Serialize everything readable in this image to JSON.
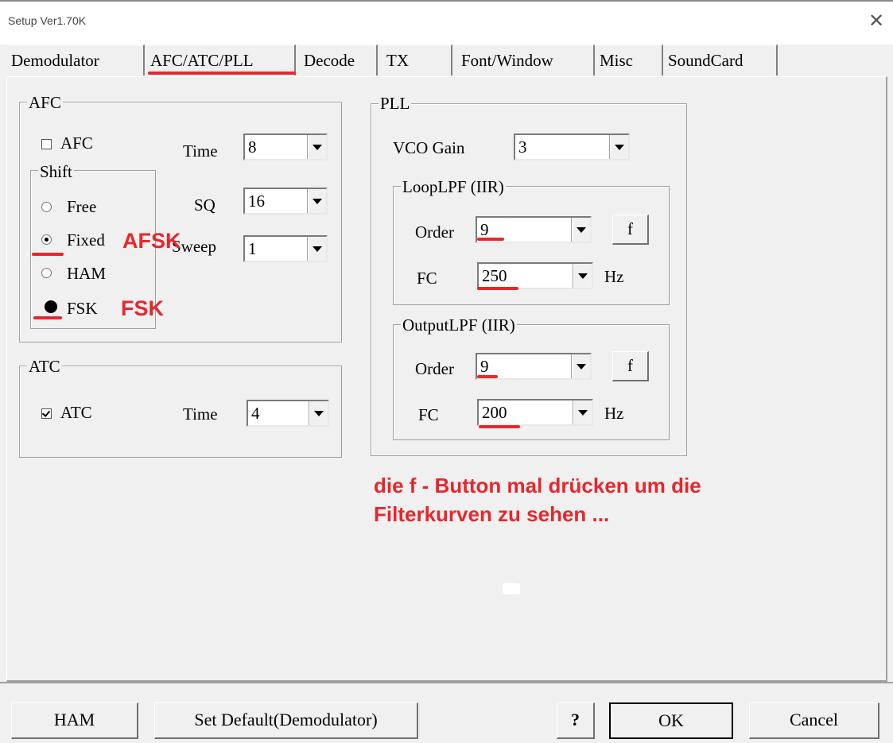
{
  "window": {
    "title": "Setup Ver1.70K"
  },
  "tabs": [
    "Demodulator",
    "AFC/ATC/PLL",
    "Decode",
    "TX",
    "Font/Window",
    "Misc",
    "SoundCard"
  ],
  "afc": {
    "legend": "AFC",
    "checkbox_label": "AFC",
    "checked": false,
    "time_label": "Time",
    "time_value": "8",
    "sq_label": "SQ",
    "sq_value": "16",
    "sweep_label": "Sweep",
    "sweep_value": "1",
    "shift": {
      "legend": "Shift",
      "options": [
        "Free",
        "Fixed",
        "HAM",
        "FSK"
      ],
      "selected": "FSK"
    }
  },
  "atc": {
    "legend": "ATC",
    "checkbox_label": "ATC",
    "checked": true,
    "time_label": "Time",
    "time_value": "4"
  },
  "pll": {
    "legend": "PLL",
    "vco_gain_label": "VCO Gain",
    "vco_gain_value": "3",
    "loop_lpf": {
      "legend": "LoopLPF (IIR)",
      "order_label": "Order",
      "order_value": "9",
      "f_button": "f",
      "fc_label": "FC",
      "fc_value": "250",
      "unit": "Hz"
    },
    "output_lpf": {
      "legend": "OutputLPF (IIR)",
      "order_label": "Order",
      "order_value": "9",
      "f_button": "f",
      "fc_label": "FC",
      "fc_value": "200",
      "unit": "Hz"
    }
  },
  "annotations": {
    "afsk": "AFSK",
    "fsk": "FSK",
    "note_line1": "die f - Button mal drücken um die",
    "note_line2": "Filterkurven zu sehen ...",
    "color": "#e8262c"
  },
  "bottom_buttons": {
    "ham": "HAM",
    "set_default": "Set Default(Demodulator)",
    "help": "?",
    "ok": "OK",
    "cancel": "Cancel"
  }
}
